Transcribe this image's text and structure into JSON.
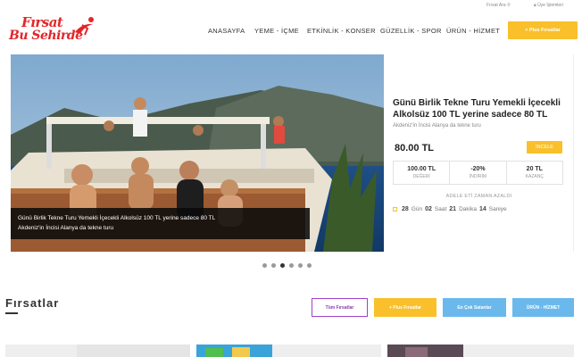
{
  "header": {
    "logo_line1": "Fırsat",
    "logo_line2": "Bu Sehirde",
    "search_label": "Fırsat Ara",
    "login_label": "Üye İşlemleri",
    "nav": [
      "ANASAYFA",
      "YEME - İÇME",
      "ETKİNLİK - KONSER",
      "GÜZELLİK - SPOR",
      "ÜRÜN - HİZMET"
    ],
    "cta_label": "+ Plus Fırsatlar"
  },
  "hero": {
    "caption_line1": "Günü Birlik Tekne Turu Yemekli İçecekli Alkolsüz 100 TL yerine sadece 80 TL",
    "caption_line2": "Akdeniz'in İncisi Alanya da tekne turu"
  },
  "deal": {
    "title": "Günü Birlik Tekne Turu Yemekli İçecekli Alkolsüz 100 TL yerine sadece 80 TL",
    "subtitle": "Akdeniz'in İncisi Alanya da tekne turu",
    "price": "80.00 TL",
    "button": "İNCELE",
    "stats": [
      {
        "value": "100.00 TL",
        "label": "DEĞERİ"
      },
      {
        "value": "-20%",
        "label": "İNDİRİM"
      },
      {
        "value": "20 TL",
        "label": "KAZANÇ"
      }
    ],
    "time_label": "ADELE ETİ ZAMAN AZALDI",
    "timer": {
      "days": "28",
      "days_label": "Gün",
      "hours": "02",
      "hours_label": "Saat",
      "minutes": "21",
      "minutes_label": "Dakika",
      "seconds": "14",
      "seconds_label": "Saniye"
    }
  },
  "slider": {
    "count": 6,
    "active": 3
  },
  "section": {
    "title": "Fırsatlar",
    "filters": [
      "Tüm Fırsatlar",
      "+ Plus Fırsatlar",
      "En Çok Satanlar",
      "ÜRÜN - HİZMET"
    ]
  },
  "colors": {
    "brand": "#e3262a",
    "accent": "#f9c02b",
    "blue": "#6ab8ec",
    "purple": "#8a3bb3"
  }
}
